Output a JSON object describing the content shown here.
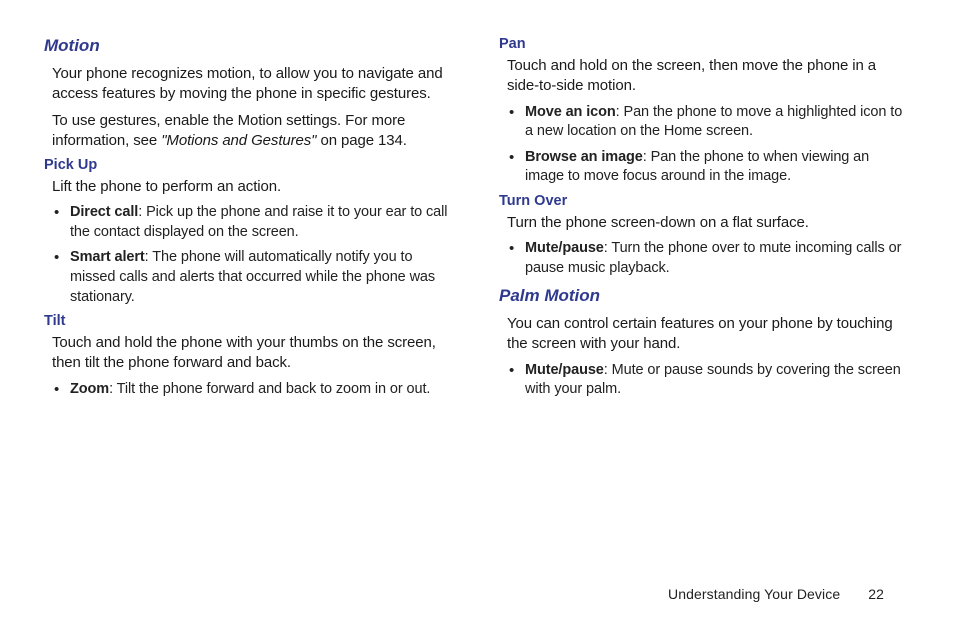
{
  "left": {
    "motion": {
      "title": "Motion",
      "p1": "Your phone recognizes motion, to allow you to navigate and access features by moving the phone in specific gestures.",
      "p2a": "To use gestures, enable the Motion settings. For more information, see ",
      "p2i": "\"Motions and Gestures\"",
      "p2b": " on page 134."
    },
    "pickup": {
      "title": "Pick Up",
      "p1": "Lift the phone to perform an action.",
      "b1_label": "Direct call",
      "b1_text": ": Pick up the phone and raise it to your ear to call the contact displayed on the screen.",
      "b2_label": "Smart alert",
      "b2_text": ": The phone will automatically notify you to missed calls and alerts that occurred while the phone was stationary."
    },
    "tilt": {
      "title": "Tilt",
      "p1": "Touch and hold the phone with your thumbs on the screen, then tilt the phone forward and back.",
      "b1_label": "Zoom",
      "b1_text": ": Tilt the phone forward and back to zoom in or out."
    }
  },
  "right": {
    "pan": {
      "title": "Pan",
      "p1": "Touch and hold on the screen, then move the phone in a side-to-side motion.",
      "b1_label": "Move an icon",
      "b1_text": ": Pan the phone to move a highlighted icon to a new location on the Home screen.",
      "b2_label": "Browse an image",
      "b2_text": ": Pan the phone to when viewing an image to move focus around in the image."
    },
    "turnover": {
      "title": "Turn Over",
      "p1": "Turn the phone screen-down on a flat surface.",
      "b1_label": "Mute/pause",
      "b1_text": ": Turn the phone over to mute incoming calls or pause music playback."
    },
    "palm": {
      "title": "Palm Motion",
      "p1": "You can control certain features on your phone by touching the screen with your hand.",
      "b1_label": "Mute/pause",
      "b1_text": ": Mute or pause sounds by covering the screen with your palm."
    }
  },
  "footer": {
    "section": "Understanding Your Device",
    "page": "22"
  }
}
